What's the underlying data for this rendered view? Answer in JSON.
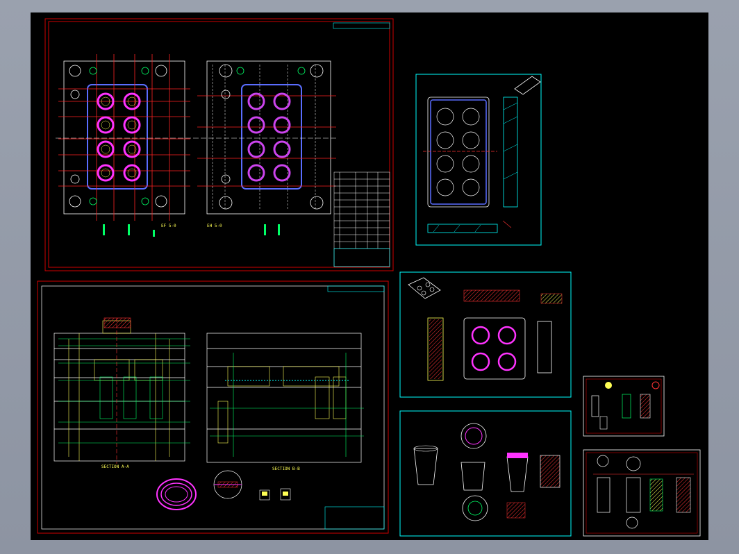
{
  "viewer": {
    "background": "#000000",
    "frame_color": "#d00000",
    "border_color": "#00ffff"
  },
  "sheets": {
    "top_left": {
      "view_label_left": "EF 5-0",
      "view_label_right": "EH 5-0"
    },
    "bottom_left": {
      "section_a": "SECTION A-A",
      "section_b": "SECTION B-B"
    }
  }
}
